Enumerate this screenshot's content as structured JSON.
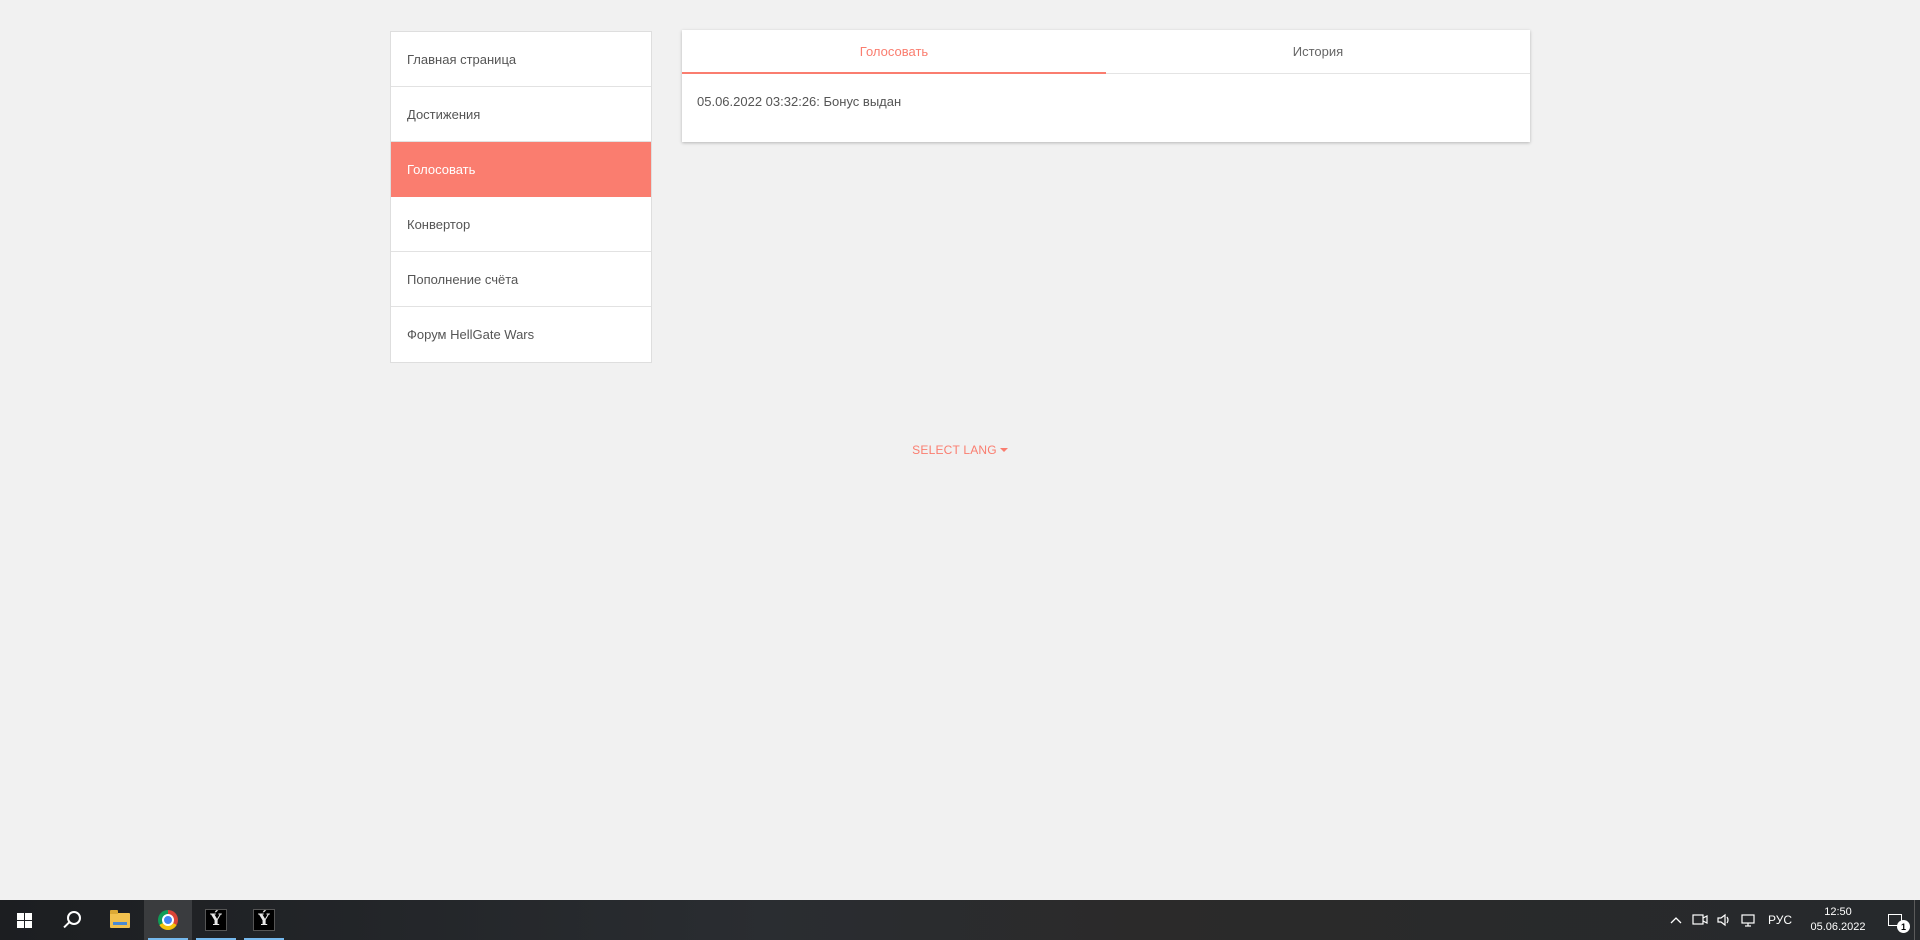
{
  "sidebar": {
    "items": [
      {
        "label": "Главная страница"
      },
      {
        "label": "Достижения"
      },
      {
        "label": "Голосовать",
        "active": true
      },
      {
        "label": "Конвертор"
      },
      {
        "label": "Пополнение счёта"
      },
      {
        "label": "Форум HellGate Wars"
      }
    ]
  },
  "main": {
    "tabs": [
      {
        "label": "Голосовать",
        "active": true
      },
      {
        "label": "История"
      }
    ],
    "entry": "05.06.2022 03:32:26: Бонус выдан"
  },
  "footer": {
    "select_lang_label": "SELECT LANG"
  },
  "taskbar": {
    "pinned": [
      "windows-start-icon",
      "search-icon",
      "file-explorer-icon",
      "chrome-icon",
      "game-app-icon",
      "game-app-icon"
    ],
    "app_glyph": "Ý",
    "tray": {
      "chevron": "^",
      "language": "РУС",
      "time": "12:50",
      "date": "05.06.2022",
      "notification_count": "1"
    }
  },
  "colors": {
    "accent": "#fa7d6f",
    "background": "#f1f1f1",
    "taskbar": "#23262a"
  }
}
